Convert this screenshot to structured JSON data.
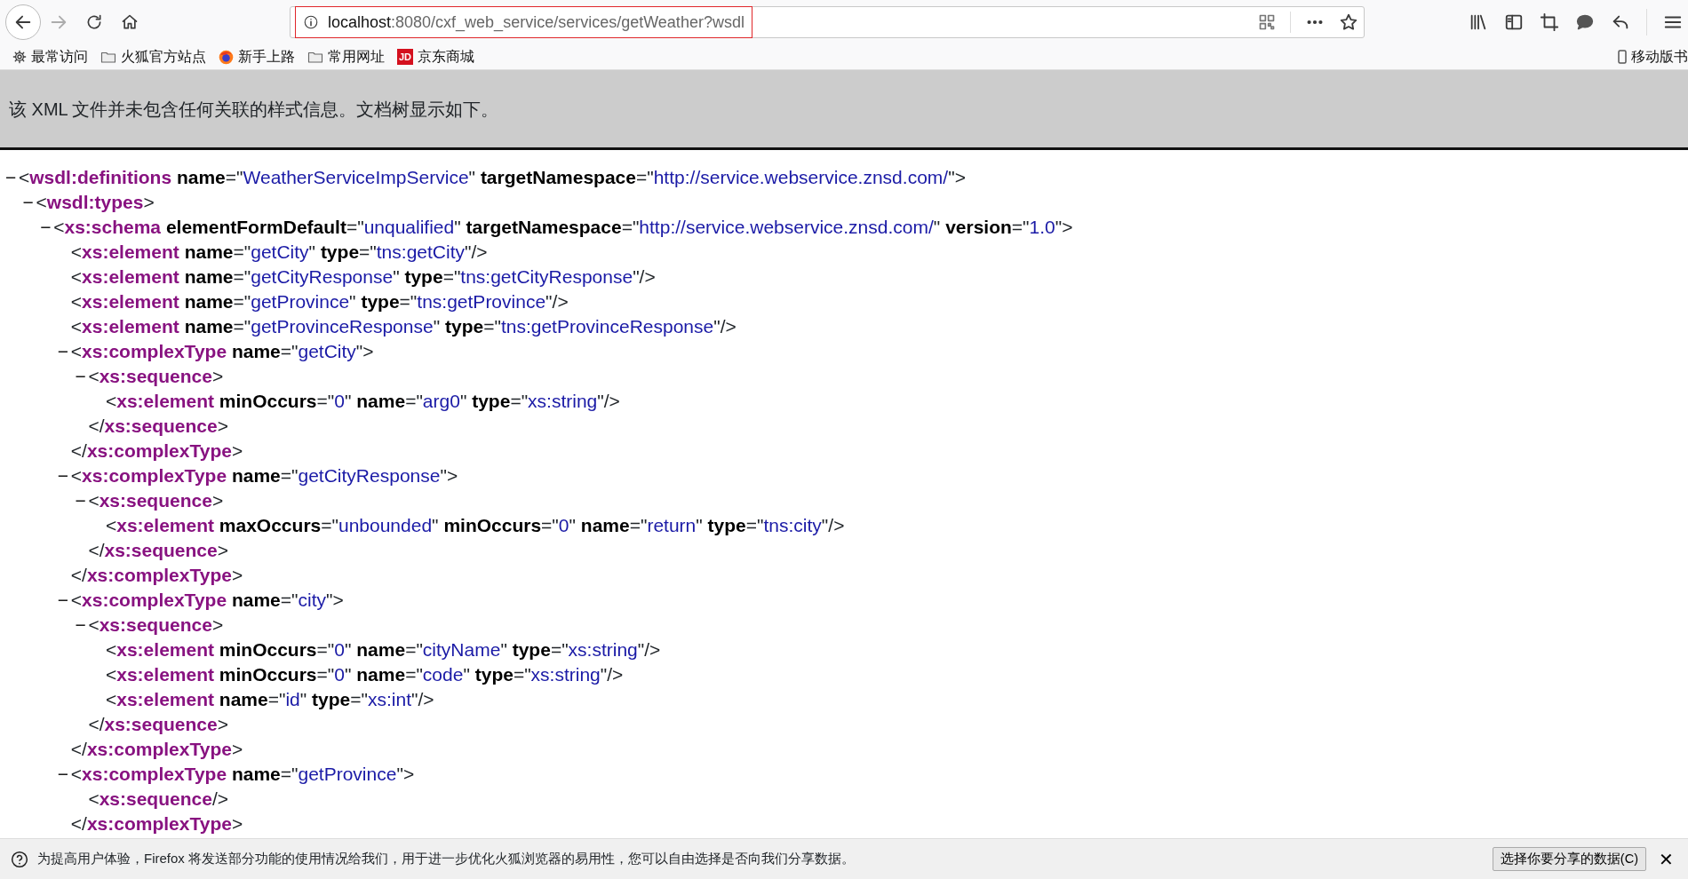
{
  "browser": {
    "url_host": "localhost",
    "url_rest": ":8080/cxf_web_service/services/getWeather?wsdl",
    "url_highlighted": true,
    "back_enabled": true,
    "forward_enabled": false
  },
  "bookmarks": [
    {
      "kind": "gear",
      "label": "最常访问"
    },
    {
      "kind": "folder",
      "label": "火狐官方站点"
    },
    {
      "kind": "firefox",
      "label": "新手上路"
    },
    {
      "kind": "folder",
      "label": "常用网址"
    },
    {
      "kind": "badge",
      "badge": "JD",
      "label": "京东商城"
    }
  ],
  "mobile_bookmarks": "移动版书",
  "xml_notice": "该 XML 文件并未包含任何关联的样式信息。文档树显示如下。",
  "syntax": {
    "lt": "<",
    "gt": ">",
    "end_lt": "</",
    "self_gt": "/>",
    "eq": "=",
    "quote": "\"",
    "toggle": "−"
  },
  "xml": {
    "tag": "wsdl:definitions",
    "attrs": [
      {
        "name": "name",
        "value": "WeatherServiceImpService"
      },
      {
        "name": "targetNamespace",
        "value": "http://service.webservice.znsd.com/"
      }
    ],
    "expanded": true,
    "children": [
      {
        "tag": "wsdl:types",
        "expanded": true,
        "children": [
          {
            "tag": "xs:schema",
            "attrs": [
              {
                "name": "elementFormDefault",
                "value": "unqualified"
              },
              {
                "name": "targetNamespace",
                "value": "http://service.webservice.znsd.com/"
              },
              {
                "name": "version",
                "value": "1.0"
              }
            ],
            "expanded": true,
            "children": [
              {
                "tag": "xs:element",
                "attrs": [
                  {
                    "name": "name",
                    "value": "getCity"
                  },
                  {
                    "name": "type",
                    "value": "tns:getCity"
                  }
                ]
              },
              {
                "tag": "xs:element",
                "attrs": [
                  {
                    "name": "name",
                    "value": "getCityResponse"
                  },
                  {
                    "name": "type",
                    "value": "tns:getCityResponse"
                  }
                ]
              },
              {
                "tag": "xs:element",
                "attrs": [
                  {
                    "name": "name",
                    "value": "getProvince"
                  },
                  {
                    "name": "type",
                    "value": "tns:getProvince"
                  }
                ]
              },
              {
                "tag": "xs:element",
                "attrs": [
                  {
                    "name": "name",
                    "value": "getProvinceResponse"
                  },
                  {
                    "name": "type",
                    "value": "tns:getProvinceResponse"
                  }
                ]
              },
              {
                "tag": "xs:complexType",
                "attrs": [
                  {
                    "name": "name",
                    "value": "getCity"
                  }
                ],
                "expanded": true,
                "closing_tag": "xs:complexType",
                "children": [
                  {
                    "tag": "xs:sequence",
                    "expanded": true,
                    "closing_tag": "xs:sequence",
                    "children": [
                      {
                        "tag": "xs:element",
                        "attrs": [
                          {
                            "name": "minOccurs",
                            "value": "0"
                          },
                          {
                            "name": "name",
                            "value": "arg0"
                          },
                          {
                            "name": "type",
                            "value": "xs:string"
                          }
                        ]
                      }
                    ]
                  }
                ]
              },
              {
                "tag": "xs:complexType",
                "attrs": [
                  {
                    "name": "name",
                    "value": "getCityResponse"
                  }
                ],
                "expanded": true,
                "closing_tag": "xs:complexType",
                "children": [
                  {
                    "tag": "xs:sequence",
                    "expanded": true,
                    "closing_tag": "xs:sequence",
                    "children": [
                      {
                        "tag": "xs:element",
                        "attrs": [
                          {
                            "name": "maxOccurs",
                            "value": "unbounded"
                          },
                          {
                            "name": "minOccurs",
                            "value": "0"
                          },
                          {
                            "name": "name",
                            "value": "return"
                          },
                          {
                            "name": "type",
                            "value": "tns:city"
                          }
                        ]
                      }
                    ]
                  }
                ]
              },
              {
                "tag": "xs:complexType",
                "attrs": [
                  {
                    "name": "name",
                    "value": "city"
                  }
                ],
                "expanded": true,
                "closing_tag": "xs:complexType",
                "children": [
                  {
                    "tag": "xs:sequence",
                    "expanded": true,
                    "closing_tag": "xs:sequence",
                    "children": [
                      {
                        "tag": "xs:element",
                        "attrs": [
                          {
                            "name": "minOccurs",
                            "value": "0"
                          },
                          {
                            "name": "name",
                            "value": "cityName"
                          },
                          {
                            "name": "type",
                            "value": "xs:string"
                          }
                        ]
                      },
                      {
                        "tag": "xs:element",
                        "attrs": [
                          {
                            "name": "minOccurs",
                            "value": "0"
                          },
                          {
                            "name": "name",
                            "value": "code"
                          },
                          {
                            "name": "type",
                            "value": "xs:string"
                          }
                        ]
                      },
                      {
                        "tag": "xs:element",
                        "attrs": [
                          {
                            "name": "name",
                            "value": "id"
                          },
                          {
                            "name": "type",
                            "value": "xs:int"
                          }
                        ]
                      }
                    ]
                  }
                ]
              },
              {
                "tag": "xs:complexType",
                "attrs": [
                  {
                    "name": "name",
                    "value": "getProvince"
                  }
                ],
                "expanded": true,
                "closing_tag": "xs:complexType",
                "children": [
                  {
                    "tag": "xs:sequence"
                  }
                ]
              }
            ]
          }
        ]
      }
    ]
  },
  "notification": {
    "message": "为提高用户体验，Firefox 将发送部分功能的使用情况给我们，用于进一步优化火狐浏览器的易用性，您可以自由选择是否向我们分享数据。",
    "button": "选择你要分享的数据(C)",
    "close": "✕"
  }
}
